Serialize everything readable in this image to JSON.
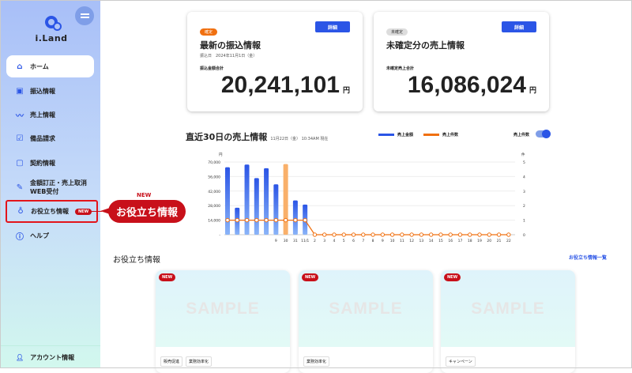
{
  "sidebar": {
    "logo": "i.Land",
    "items": [
      {
        "label": "ホーム",
        "icon": "home-icon",
        "active": true
      },
      {
        "label": "振込情報",
        "icon": "transfer-icon"
      },
      {
        "label": "売上情報",
        "icon": "trend-icon"
      },
      {
        "label": "備品請求",
        "icon": "checklist-icon"
      },
      {
        "label": "契約情報",
        "icon": "clipboard-icon"
      },
      {
        "label": "金額訂正・売上取消",
        "label2": "WEB受付",
        "icon": "pencil-icon"
      },
      {
        "label": "お役立ち情報",
        "icon": "lightbulb-icon",
        "badge": "NEW"
      },
      {
        "label": "ヘルプ",
        "icon": "help-icon"
      }
    ],
    "account": "アカウント情報"
  },
  "callout": {
    "label": "お役立ち情報",
    "new": "NEW"
  },
  "cards": [
    {
      "badge": "確定",
      "title": "最新の振込情報",
      "sub": "振込日　2024年11月1日（金）",
      "amount_label": "振込金額合計",
      "amount": "20,241,101",
      "unit": "円",
      "button": "詳細"
    },
    {
      "badge": "未確定",
      "title": "未確定分の売上情報",
      "amount_label": "未確定売上合計",
      "amount": "16,086,024",
      "unit": "円",
      "button": "詳細"
    }
  ],
  "chart_header": {
    "title": "直近30日の売上情報",
    "timestamp": "11月22日（金） 10:34AM 現在",
    "toggle_label": "売上件数",
    "toggle_on": true
  },
  "chart_data": {
    "type": "bar",
    "categories": [
      "",
      "",
      "",
      "",
      "",
      "9",
      "30",
      "31",
      "11/1",
      "2",
      "3",
      "4",
      "5",
      "6",
      "7",
      "8",
      "9",
      "10",
      "11",
      "12",
      "13",
      "14",
      "15",
      "16",
      "17",
      "18",
      "19",
      "20",
      "21",
      "22"
    ],
    "series": [
      {
        "name": "売上金額",
        "type": "bar",
        "axis": "left",
        "color": "#2b55e6",
        "values": [
          65000,
          26000,
          67500,
          54500,
          64000,
          48500,
          68000,
          33000,
          29000,
          0,
          0,
          0,
          0,
          0,
          0,
          0,
          0,
          0,
          0,
          0,
          0,
          0,
          0,
          0,
          0,
          0,
          0,
          0,
          0,
          0
        ]
      },
      {
        "name": "売上件数",
        "type": "line",
        "axis": "right",
        "color": "#f07010",
        "values": [
          1,
          1,
          1,
          1,
          1,
          1,
          1,
          1,
          1,
          0,
          0,
          0,
          0,
          0,
          0,
          0,
          0,
          0,
          0,
          0,
          0,
          0,
          0,
          0,
          0,
          0,
          0,
          0,
          0,
          0
        ]
      }
    ],
    "highlight_index": 6,
    "highlight_color": "#f9b06a",
    "left_axis": {
      "unit": "円",
      "ylim": [
        0,
        70000
      ],
      "ticks": [
        "-",
        "14,000",
        "28,000",
        "42,000",
        "56,000",
        "70,000"
      ]
    },
    "right_axis": {
      "unit": "件",
      "ylim": [
        0,
        5
      ],
      "ticks": [
        "0",
        "1",
        "2",
        "3",
        "4",
        "5"
      ]
    },
    "legend": "top",
    "grid": true
  },
  "info": {
    "title": "お役立ち情報",
    "link": "お役立ち情報一覧",
    "cards": [
      {
        "badge": "NEW",
        "image": "SAMPLE",
        "tags": [
          "販売促進",
          "業務効率化"
        ]
      },
      {
        "badge": "NEW",
        "image": "SAMPLE",
        "tags": [
          "業務効率化"
        ]
      },
      {
        "badge": "NEW",
        "image": "SAMPLE",
        "tags": [
          "キャンペーン"
        ]
      }
    ]
  },
  "colors": {
    "accent": "#2b55e6",
    "orange": "#f07010",
    "red": "#c8101a"
  }
}
